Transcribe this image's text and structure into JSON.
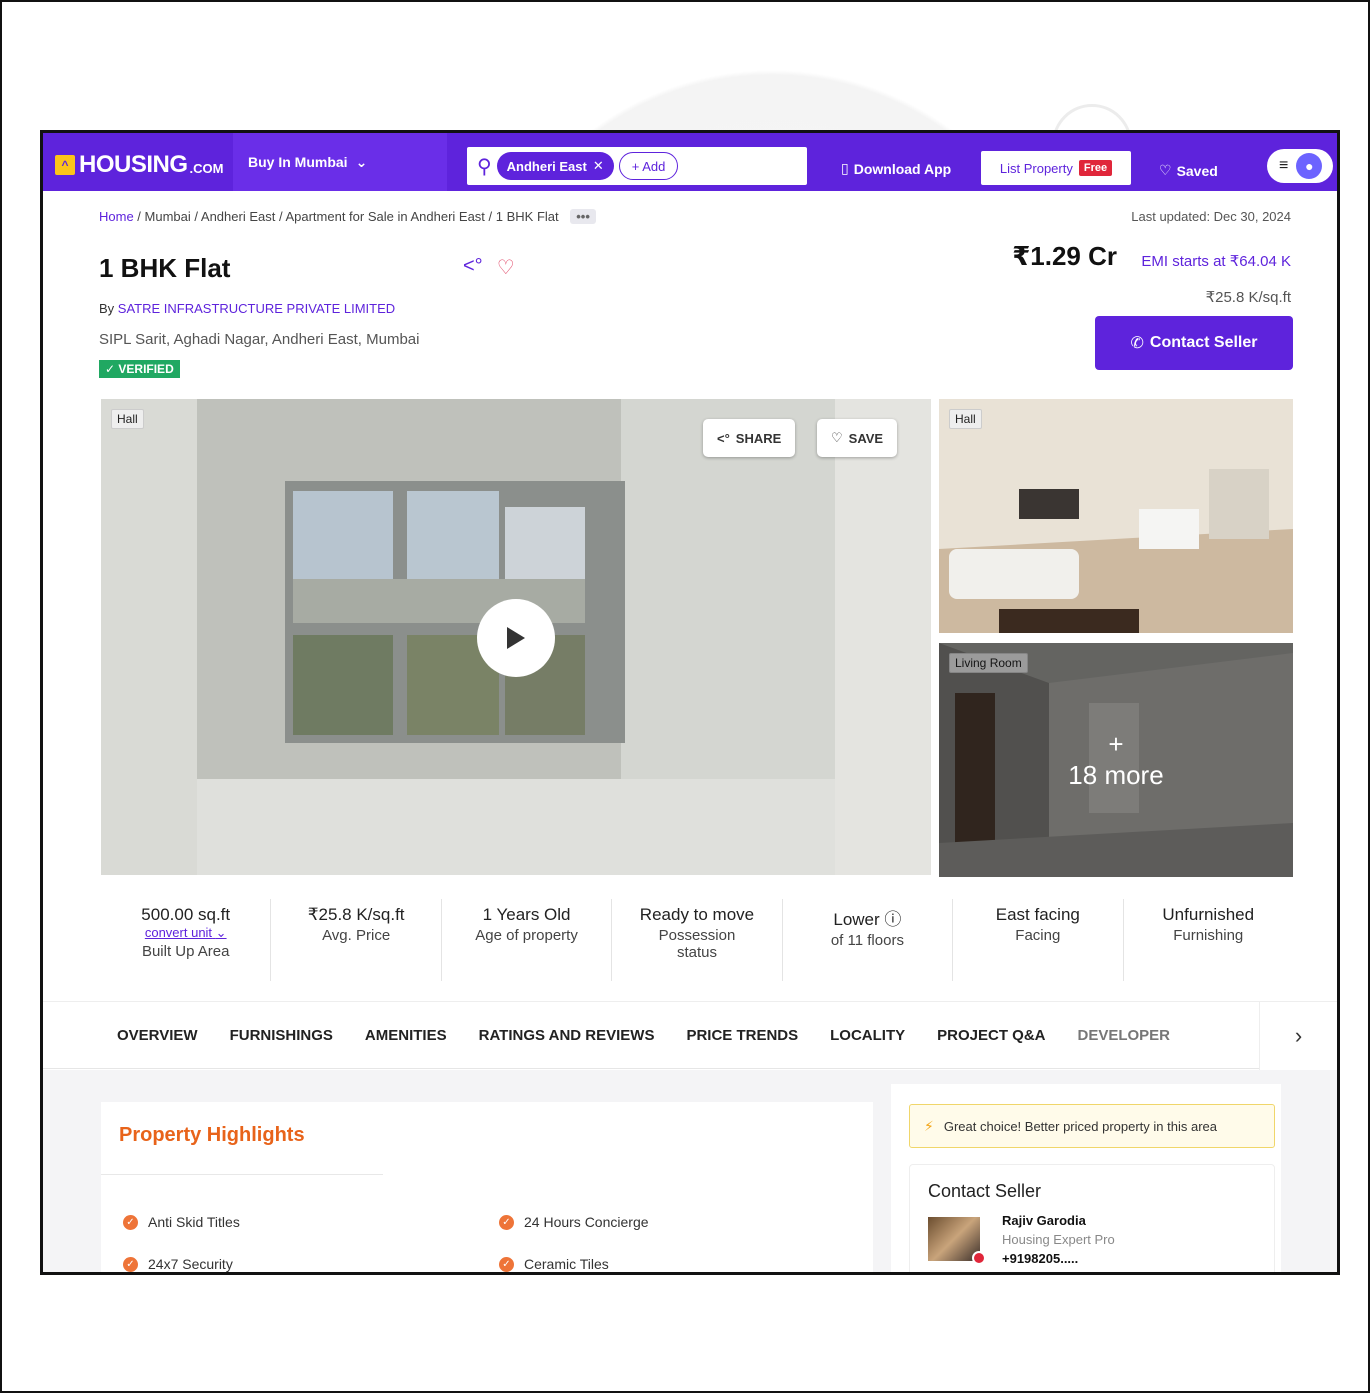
{
  "header": {
    "logo_text": "HOUSING",
    "logo_suffix": ".COM",
    "buy_in": "Buy In Mumbai",
    "search_chip": "Andheri East",
    "add_label": "+ Add",
    "download_app": "Download App",
    "list_property": "List Property",
    "free_badge": "Free",
    "saved": "Saved"
  },
  "breadcrumb": {
    "home": "Home",
    "mumbai": "Mumbai",
    "locality": "Andheri East",
    "category": "Apartment for Sale in Andheri East",
    "current": "1 BHK Flat",
    "more": "•••"
  },
  "last_updated": "Last updated: Dec 30, 2024",
  "property": {
    "title": "1 BHK Flat",
    "by_prefix": "By",
    "developer": "SATRE INFRASTRUCTURE PRIVATE LIMITED",
    "address": "SIPL Sarit, Aghadi Nagar, Andheri East, Mumbai",
    "verified": "✓ VERIFIED",
    "price": "₹1.29 Cr",
    "emi": "EMI starts at ₹64.04 K",
    "price_per_sqft": "₹25.8 K/sq.ft",
    "contact_button": "Contact Seller"
  },
  "gallery": {
    "main_tag": "Hall",
    "share": "SHARE",
    "save": "SAVE",
    "side1_tag": "Hall",
    "side2_tag": "Living Room",
    "more_plus": "+",
    "more_label": "18 more"
  },
  "facts": [
    {
      "value": "500.00 sq.ft",
      "link": "convert unit",
      "label": "Built Up Area"
    },
    {
      "value": "₹25.8 K/sq.ft",
      "label": "Avg. Price"
    },
    {
      "value": "1 Years Old",
      "label": "Age of property"
    },
    {
      "value": "Ready to move",
      "label": "Possession status"
    },
    {
      "value": "Lower",
      "label": "of 11 floors"
    },
    {
      "value": "East facing",
      "label": "Facing"
    },
    {
      "value": "Unfurnished",
      "label": "Furnishing"
    }
  ],
  "tabs": [
    "OVERVIEW",
    "FURNISHINGS",
    "AMENITIES",
    "RATINGS AND REVIEWS",
    "PRICE TRENDS",
    "LOCALITY",
    "PROJECT Q&A",
    "DEVELOPER"
  ],
  "highlights": {
    "title": "Property Highlights",
    "items": [
      "Anti Skid Titles",
      "24 Hours Concierge",
      "24x7 Security",
      "Ceramic Tiles"
    ]
  },
  "side": {
    "choice": "Great choice! Better priced property in this area",
    "contact_title": "Contact Seller",
    "agent_name": "Rajiv Garodia",
    "agent_role": "Housing Expert Pro",
    "agent_phone": "+9198205....."
  },
  "colors": {
    "brand": "#5e23dc",
    "accent_orange": "#e8631a",
    "verified_green": "#20a862"
  },
  "icons": [
    "search-icon",
    "chevron-down-icon",
    "phone-icon",
    "share-icon",
    "heart-icon",
    "play-icon",
    "info-icon",
    "chevron-right-icon",
    "bolt-icon",
    "check-icon",
    "menu-icon"
  ]
}
